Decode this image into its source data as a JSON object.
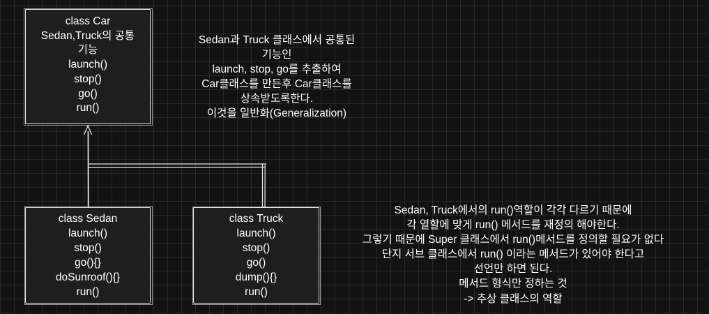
{
  "diagram": {
    "classes": {
      "car": {
        "lines": [
          "class Car",
          "Sedan,Truck의 공통",
          "기능",
          "launch()",
          "stop()",
          "go()",
          "run()"
        ]
      },
      "sedan": {
        "lines": [
          "class Sedan",
          "launch()",
          "stop()",
          "go(){}",
          "doSunroof(){}",
          "run()"
        ]
      },
      "truck": {
        "lines": [
          "class Truck",
          "launch()",
          "stop()",
          "go()",
          "dump(){}",
          "run()"
        ]
      }
    },
    "notes": {
      "generalization": [
        "Sedan과 Truck 클래스에서 공통된",
        "기능인",
        "launch, stop, go를 추출하여",
        "Car클래스를 만든후 Car클래스를",
        "상속받도록한다.",
        "이것을 일반화(Generalization)"
      ],
      "abstract": [
        "Sedan, Truck에서의 run()역할이 각각 다르기 때문에",
        "각 열할에 맞게 run() 메서드를 재정의 해야한다.",
        "그렇기 때문에 Super 클래스에서 run()메서드를 정의할 필요가 없다",
        "단지 서브 클래스에서 run() 이라는 메서드가 있어야 한다고",
        "선언만 하면 된다.",
        "메서드 형식만 정하는 것",
        "-> 추상 클래스의 역할"
      ]
    },
    "colors": {
      "background": "#121212",
      "box_fill": "#1e1e1e",
      "stroke": "#e8e8e8",
      "text": "#ffffff"
    }
  }
}
